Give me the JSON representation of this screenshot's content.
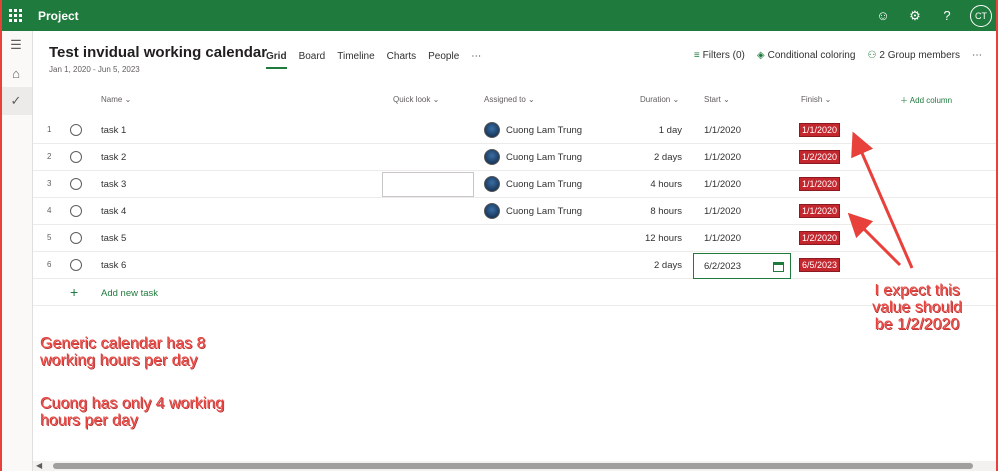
{
  "app": {
    "name": "Project",
    "user_initials": "CT"
  },
  "project": {
    "title": "Test invidual working calendar",
    "dates": "Jan 1, 2020 - Jun 5, 2023"
  },
  "tabs": [
    "Grid",
    "Board",
    "Timeline",
    "Charts",
    "People",
    "⋯"
  ],
  "actions": {
    "filters": "Filters (0)",
    "coloring": "Conditional coloring",
    "members": "2 Group members",
    "more": "⋯"
  },
  "columns": {
    "name": "Name",
    "quick": "Quick look",
    "assigned": "Assigned to",
    "duration": "Duration",
    "start": "Start",
    "finish": "Finish",
    "add": "Add column"
  },
  "tasks": [
    {
      "num": "1",
      "name": "task 1",
      "assignee": "Cuong Lam Trung",
      "duration": "1 day",
      "start": "1/1/2020",
      "finish": "1/1/2020"
    },
    {
      "num": "2",
      "name": "task 2",
      "assignee": "Cuong Lam Trung",
      "duration": "2 days",
      "start": "1/1/2020",
      "finish": "1/2/2020"
    },
    {
      "num": "3",
      "name": "task 3",
      "assignee": "Cuong Lam Trung",
      "duration": "4 hours",
      "start": "1/1/2020",
      "finish": "1/1/2020"
    },
    {
      "num": "4",
      "name": "task 4",
      "assignee": "Cuong Lam Trung",
      "duration": "8 hours",
      "start": "1/1/2020",
      "finish": "1/1/2020"
    },
    {
      "num": "5",
      "name": "task 5",
      "assignee": "",
      "duration": "12 hours",
      "start": "1/1/2020",
      "finish": "1/2/2020"
    },
    {
      "num": "6",
      "name": "task 6",
      "assignee": "",
      "duration": "2 days",
      "start": "6/2/2023",
      "finish": "6/5/2023"
    }
  ],
  "add_task": "Add new task",
  "annotations": {
    "expect": "I expect this value should be 1/2/2020",
    "generic": "Generic calendar has 8 working hours per day",
    "cuong": "Cuong has only 4 working hours per day"
  },
  "colors": {
    "brand": "#1f7a3d",
    "finish_highlight": "#c4262e",
    "annotation": "#e8403b"
  }
}
